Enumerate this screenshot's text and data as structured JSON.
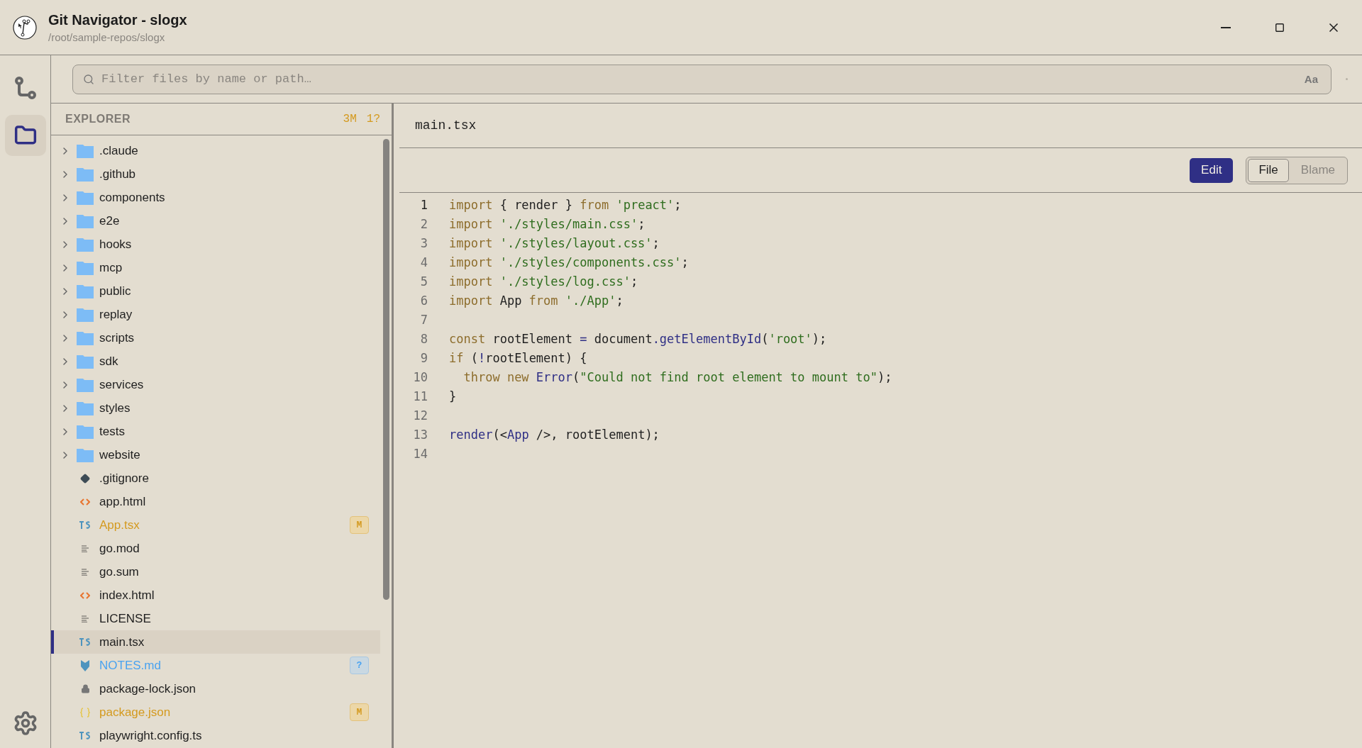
{
  "window": {
    "title": "Git Navigator - slogx",
    "subtitle": "/root/sample-repos/slogx"
  },
  "rail": [
    {
      "kind": "branch",
      "selected": false
    },
    {
      "kind": "folder",
      "selected": true
    }
  ],
  "search": {
    "placeholder": "Filter files by name or path…",
    "case_toggle": "Aa"
  },
  "explorer": {
    "title": "EXPLORER",
    "counts": [
      "3M",
      "1?"
    ],
    "items": [
      {
        "name": ".claude",
        "kind": "folder",
        "selected": false
      },
      {
        "name": ".github",
        "kind": "folder",
        "selected": false
      },
      {
        "name": "components",
        "kind": "folder",
        "selected": false
      },
      {
        "name": "e2e",
        "kind": "folder",
        "selected": false
      },
      {
        "name": "hooks",
        "kind": "folder",
        "selected": false
      },
      {
        "name": "mcp",
        "kind": "folder",
        "selected": false
      },
      {
        "name": "public",
        "kind": "folder",
        "selected": false
      },
      {
        "name": "replay",
        "kind": "folder",
        "selected": false
      },
      {
        "name": "scripts",
        "kind": "folder",
        "selected": false
      },
      {
        "name": "sdk",
        "kind": "folder",
        "selected": false
      },
      {
        "name": "services",
        "kind": "folder",
        "selected": false
      },
      {
        "name": "styles",
        "kind": "folder",
        "selected": false
      },
      {
        "name": "tests",
        "kind": "folder",
        "selected": false
      },
      {
        "name": "website",
        "kind": "folder",
        "selected": false
      },
      {
        "name": ".gitignore",
        "kind": "git",
        "selected": false
      },
      {
        "name": "app.html",
        "kind": "html",
        "selected": false
      },
      {
        "name": "App.tsx",
        "kind": "ts",
        "selected": false,
        "status": "M"
      },
      {
        "name": "go.mod",
        "kind": "text",
        "selected": false
      },
      {
        "name": "go.sum",
        "kind": "text",
        "selected": false
      },
      {
        "name": "index.html",
        "kind": "html",
        "selected": false
      },
      {
        "name": "LICENSE",
        "kind": "text",
        "selected": false
      },
      {
        "name": "main.tsx",
        "kind": "ts",
        "selected": true
      },
      {
        "name": "NOTES.md",
        "kind": "markdown",
        "selected": false,
        "status": "?"
      },
      {
        "name": "package-lock.json",
        "kind": "lock",
        "selected": false
      },
      {
        "name": "package.json",
        "kind": "json",
        "selected": false,
        "status": "M"
      },
      {
        "name": "playwright.config.ts",
        "kind": "ts",
        "selected": false
      }
    ]
  },
  "editor": {
    "file_name": "main.tsx",
    "edit_button": "Edit",
    "view_tabs": [
      {
        "label": "File",
        "selected": true
      },
      {
        "label": "Blame",
        "selected": false
      }
    ],
    "lines": [
      {
        "number": "1",
        "active": true,
        "tokens": [
          {
            "text": "import",
            "kind": "keyword"
          },
          {
            "text": " { render } ",
            "kind": "plain"
          },
          {
            "text": "from",
            "kind": "keyword"
          },
          {
            "text": " 'preact'",
            "kind": "string"
          },
          {
            "text": ";",
            "kind": "plain"
          }
        ]
      },
      {
        "number": "2",
        "active": false,
        "tokens": [
          {
            "text": "import",
            "kind": "keyword"
          },
          {
            "text": " './styles/main.css'",
            "kind": "string"
          },
          {
            "text": ";",
            "kind": "plain"
          }
        ]
      },
      {
        "number": "3",
        "active": false,
        "tokens": [
          {
            "text": "import",
            "kind": "keyword"
          },
          {
            "text": " './styles/layout.css'",
            "kind": "string"
          },
          {
            "text": ";",
            "kind": "plain"
          }
        ]
      },
      {
        "number": "4",
        "active": false,
        "tokens": [
          {
            "text": "import",
            "kind": "keyword"
          },
          {
            "text": " './styles/components.css'",
            "kind": "string"
          },
          {
            "text": ";",
            "kind": "plain"
          }
        ]
      },
      {
        "number": "5",
        "active": false,
        "tokens": [
          {
            "text": "import",
            "kind": "keyword"
          },
          {
            "text": " './styles/log.css'",
            "kind": "string"
          },
          {
            "text": ";",
            "kind": "plain"
          }
        ]
      },
      {
        "number": "6",
        "active": false,
        "tokens": [
          {
            "text": "import",
            "kind": "keyword"
          },
          {
            "text": " App ",
            "kind": "plain"
          },
          {
            "text": "from",
            "kind": "keyword"
          },
          {
            "text": " './App'",
            "kind": "string"
          },
          {
            "text": ";",
            "kind": "plain"
          }
        ]
      },
      {
        "number": "7",
        "active": false
      },
      {
        "number": "8",
        "active": false,
        "tokens": [
          {
            "text": "const",
            "kind": "keyword"
          },
          {
            "text": " rootElement ",
            "kind": "plain"
          },
          {
            "text": "=",
            "kind": "function"
          },
          {
            "text": " document",
            "kind": "plain"
          },
          {
            "text": ".getElementById",
            "kind": "function"
          },
          {
            "text": "(",
            "kind": "plain"
          },
          {
            "text": "'root'",
            "kind": "string"
          },
          {
            "text": ");",
            "kind": "plain"
          }
        ]
      },
      {
        "number": "9",
        "active": false,
        "tokens": [
          {
            "text": "if",
            "kind": "keyword"
          },
          {
            "text": " (",
            "kind": "plain"
          },
          {
            "text": "!",
            "kind": "function"
          },
          {
            "text": "rootElement) {",
            "kind": "plain"
          }
        ]
      },
      {
        "number": "10",
        "active": false,
        "tokens": [
          {
            "text": "  throw",
            "kind": "keyword"
          },
          {
            "text": " new",
            "kind": "keyword"
          },
          {
            "text": " Error",
            "kind": "function"
          },
          {
            "text": "(",
            "kind": "plain"
          },
          {
            "text": "\"Could not find root element to mount to\"",
            "kind": "string"
          },
          {
            "text": ");",
            "kind": "plain"
          }
        ]
      },
      {
        "number": "11",
        "active": false,
        "tokens": [
          {
            "text": "}",
            "kind": "plain"
          }
        ]
      },
      {
        "number": "12",
        "active": false
      },
      {
        "number": "13",
        "active": false,
        "tokens": [
          {
            "text": "render",
            "kind": "function"
          },
          {
            "text": "(<",
            "kind": "plain"
          },
          {
            "text": "App",
            "kind": "function"
          },
          {
            "text": " />, rootElement);",
            "kind": "plain"
          }
        ]
      },
      {
        "number": "14",
        "active": false
      }
    ]
  }
}
